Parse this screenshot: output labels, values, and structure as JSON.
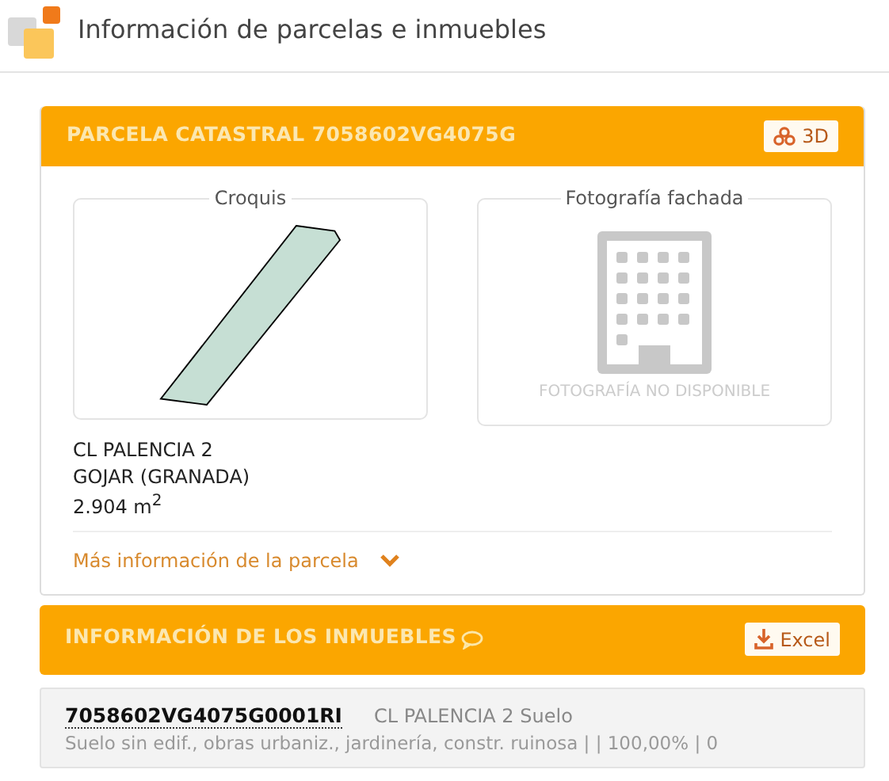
{
  "header": {
    "title": "Información de parcelas e inmuebles"
  },
  "parcel": {
    "title": "PARCELA CATASTRAL 7058602VG4075G",
    "button_3d": "3D",
    "sketch": {
      "legend": "Croquis"
    },
    "photo": {
      "legend": "Fotografía fachada",
      "unavailable": "FOTOGRAFÍA NO DISPONIBLE"
    },
    "address": [
      "CL PALENCIA 2",
      "GOJAR (GRANADA)",
      "2.904 m$^{2}$"
    ],
    "more_link": "Más información de la parcela",
    "expanded": false
  },
  "properties": {
    "title": "INFORMACIÓN DE LOS INMUEBLES",
    "excel_button": "Excel",
    "items": [
      {
        "reference": "7058602VG4075G0001RI",
        "location": "CL PALENCIA 2 Suelo",
        "description": "Suelo sin edif., obras urbaniz., jardinería, constr. ruinosa | | 100,00% | 0"
      }
    ]
  }
}
